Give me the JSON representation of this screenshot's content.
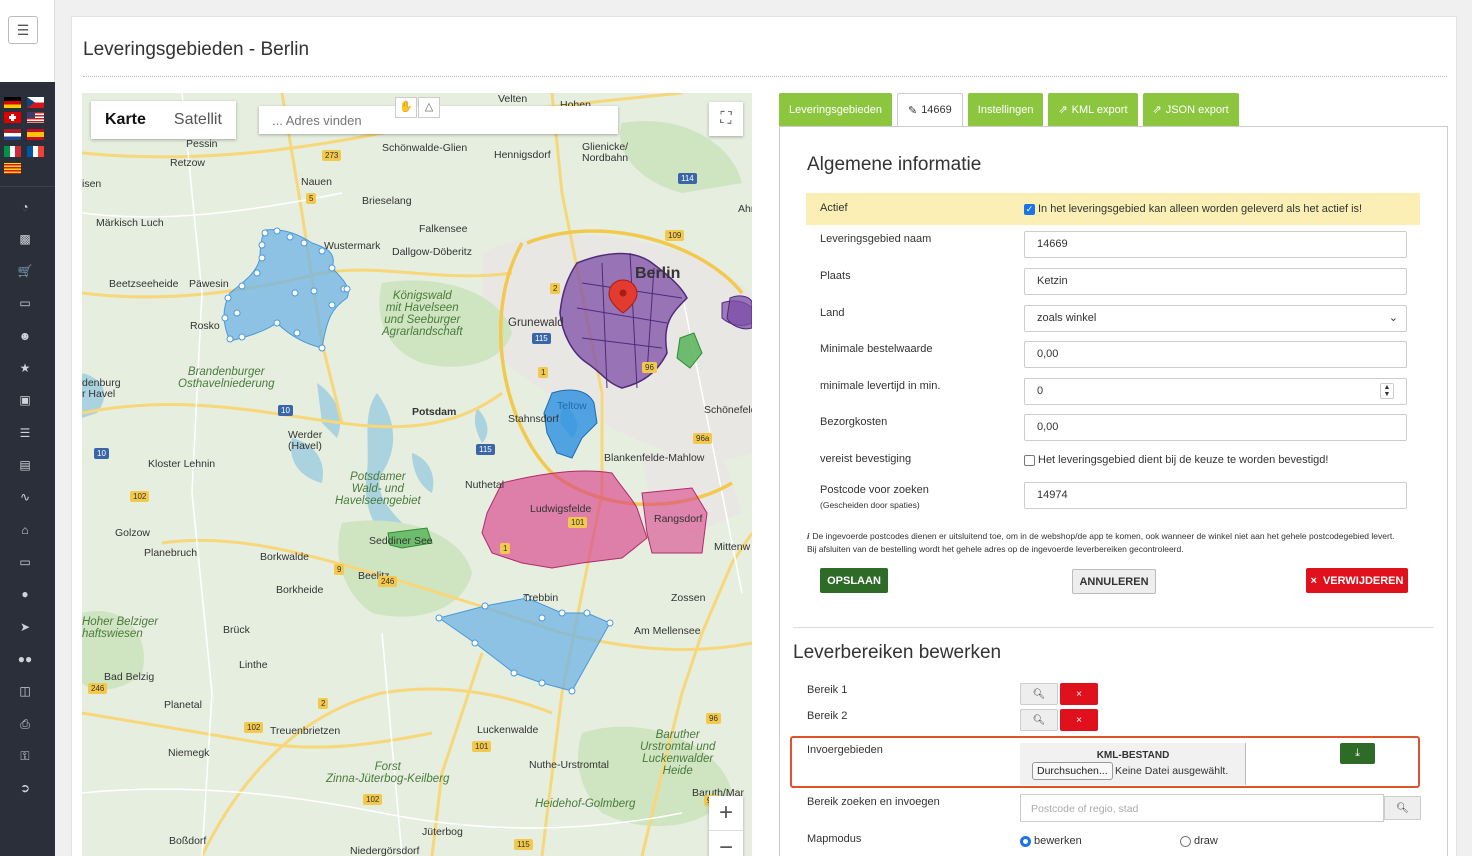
{
  "page": {
    "title": "Leveringsgebieden - Berlin"
  },
  "sidebar": {
    "menu_icon": "hamburger-icon",
    "flags": [
      "de",
      "cz",
      "ch",
      "us",
      "nl",
      "es",
      "it",
      "fr",
      "ca"
    ],
    "icons": [
      "speedometer-icon",
      "bar-chart-icon",
      "cart-icon",
      "monitor-icon",
      "user-plus-icon",
      "star-icon",
      "archive-icon",
      "list-icon",
      "book-icon",
      "trend-icon",
      "home-icon",
      "desktop-icon",
      "user-icon",
      "rocket-icon",
      "users-icon",
      "database-icon",
      "printer-icon",
      "key-icon",
      "logout-icon"
    ]
  },
  "map": {
    "type_map": "Karte",
    "type_satellite": "Satellit",
    "search_placeholder": "... Adres vinden",
    "zoom_in": "+",
    "zoom_out": "−",
    "labels": {
      "berlin": "Berlin",
      "pessin": "Pessin",
      "retzow": "Retzow",
      "nauen": "Nauen",
      "isen": "isen",
      "markisch_luch": "Märkisch Luch",
      "beetzsee": "Beetzseeheide",
      "pawesin": "Päwesin",
      "rosko": "Rosko",
      "wustermark": "Wustermark",
      "dallgow": "Dallgow-Döberitz",
      "brieselang": "Brieselang",
      "falkensee": "Falkensee",
      "schonwalde": "Schönwalde-Glien",
      "hennigsdorf": "Hennigsdorf",
      "velten": "Velten",
      "hohen": "Hohen",
      "glienicke": "Glienicke/\nNordbahn",
      "ahr": "Ahr",
      "grunewald": "Grunewald",
      "potsdam": "Potsdam",
      "stahnsdorf": "Stahnsdorf",
      "teltow": "Teltow",
      "schonefeld": "Schönefeld",
      "blankenfelde": "Blankenfelde-Mahlow",
      "nuthetal": "Nuthetal",
      "ludwigsfelde": "Ludwigsfelde",
      "rangsdorf": "Rangsdorf",
      "mittenw": "Mittenw",
      "werder": "Werder\n(Havel)",
      "kloster": "Kloster Lehnin",
      "golzow": "Golzow",
      "planebruch": "Planebruch",
      "borkwalde": "Borkwalde",
      "borkheide": "Borkheide",
      "seddiner": "Seddiner See",
      "beelitz": "Beelitz",
      "trebbin": "Trebbin",
      "zossen": "Zossen",
      "am_mellensee": "Am Mellensee",
      "bruck": "Brück",
      "linthe": "Linthe",
      "hoher": "Hoher Belziger\nhaftswiesen",
      "bad_belzig": "Bad Belzig",
      "planetal": "Planetal",
      "niemegk": "Niemegk",
      "treuenbrietzen": "Treuenbrietzen",
      "luckenwalde": "Luckenwalde",
      "nuthe": "Nuthe-Urstromtal",
      "baruther": "Baruther\nUrstromtal und\nLuckenwalder\nHeide",
      "heidehof": "Heidehof-Golmberg",
      "baruth": "Baruth/Mar",
      "zinna": "Forst\nZinna-Jüterbog-Keilberg",
      "jueterbog": "Jüterbog",
      "bossdorf": "Boßdorf",
      "niedergorsdorf": "Niedergörsdorf",
      "denburg": "denburg\nr Havel",
      "koenigswald": "Königswald\nmit Havelseen\nund Seeburger\nAgrarlandschaft",
      "brandenburger": "Brandenburger\nOsthavelniederung",
      "potsdamer_wald": "Potsdamer\nWald- und\nHavelseengebiet"
    },
    "shields": [
      "273",
      "5",
      "10",
      "109",
      "96",
      "114",
      "2",
      "115",
      "1",
      "10",
      "115",
      "96a",
      "101",
      "1",
      "102",
      "9",
      "246",
      "96",
      "2",
      "246",
      "102",
      "101",
      "96",
      "102",
      "115"
    ]
  },
  "tabs": [
    {
      "label": "Leveringsgebieden",
      "icon": ""
    },
    {
      "label": "14669",
      "icon": "pencil-icon"
    },
    {
      "label": "Instellingen",
      "icon": ""
    },
    {
      "label": "KML export",
      "icon": "external-link-icon"
    },
    {
      "label": "JSON export",
      "icon": "external-link-icon"
    }
  ],
  "general": {
    "title": "Algemene informatie",
    "active_label": "Actief",
    "active_checked": true,
    "active_text": "In het leveringsgebied kan alleen worden geleverd als het actief is!",
    "name_label": "Leveringsgebied naam",
    "name_value": "14669",
    "city_label": "Plaats",
    "city_value": "Ketzin",
    "country_label": "Land",
    "country_value": "zoals winkel",
    "min_order_label": "Minimale bestelwaarde",
    "min_order_value": "0,00",
    "min_time_label": "minimale levertijd in min.",
    "min_time_value": "0",
    "delivery_cost_label": "Bezorgkosten",
    "delivery_cost_value": "0,00",
    "confirm_label": "vereist bevestiging",
    "confirm_checked": false,
    "confirm_text": "Het leveringsgebied dient bij de keuze te worden bevestigd!",
    "postcode_label": "Postcode voor zoeken",
    "postcode_sublabel": "(Gescheiden door spaties)",
    "postcode_value": "14974",
    "note_line1": "De ingevoerde postcodes dienen er uitsluitend toe, om in de webshop/de app te komen, ook wanneer de winkel niet aan het gehele postcodegebied levert.",
    "note_line2": "Bij afsluiten van de bestelling wordt het gehele adres op de ingevoerde leverbereiken gecontroleerd.",
    "save": "OPSLAAN",
    "cancel": "ANNULEREN",
    "delete": "VERWIJDEREN"
  },
  "zones": {
    "title": "Leverbereiken bewerken",
    "zone1": "Bereik 1",
    "zone2": "Bereik 2",
    "import_label": "Invoergebieden",
    "kml_title": "KML-BESTAND",
    "browse": "Durchsuchen...",
    "no_file": "Keine Datei ausgewählt.",
    "search_label": "Bereik zoeken en invoegen",
    "search_placeholder": "Postcode of regio, stad",
    "mapmode_label": "Mapmodus",
    "mode_edit": "bewerken",
    "mode_draw": "draw",
    "mode_selected": "bewerken"
  },
  "colors": {
    "tab_green": "#8cc63f",
    "save_green": "#2d6b27",
    "delete_red": "#e0101d",
    "highlight_yellow": "#fbefb5",
    "import_border": "#e0522a"
  }
}
